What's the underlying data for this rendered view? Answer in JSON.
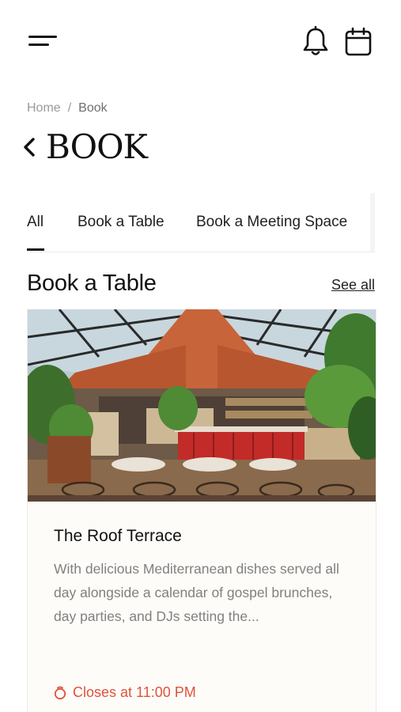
{
  "header": {
    "icons": [
      "menu-icon",
      "bell-icon",
      "calendar-icon"
    ]
  },
  "breadcrumb": {
    "home": "Home",
    "separator": "/",
    "current": "Book"
  },
  "page": {
    "title": "BOOK"
  },
  "tabs": [
    {
      "label": "All",
      "active": true
    },
    {
      "label": "Book a Table",
      "active": false
    },
    {
      "label": "Book a Meeting Space",
      "active": false
    }
  ],
  "section": {
    "title": "Book a Table",
    "see_all": "See all"
  },
  "card": {
    "title": "The Roof Terrace",
    "description": "With delicious Mediterranean dishes served all day alongside a calendar of gospel brunches, day parties, and DJs setting the...",
    "status": "Closes at 11:00 PM",
    "status_icon": "clock-icon"
  },
  "colors": {
    "accent": "#e0523c",
    "text": "#111111",
    "muted": "#808080",
    "card_bg": "#fdfcf9"
  }
}
